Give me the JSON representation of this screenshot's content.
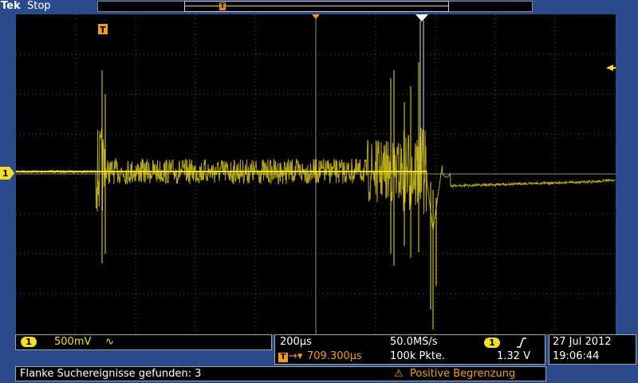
{
  "header": {
    "brand": "Tek",
    "status": "Stop"
  },
  "channel": {
    "label": "1",
    "scale": "500mV",
    "coupling_symbol": "∿"
  },
  "timebase": {
    "scale": "200µs",
    "sample_rate": "50.0MS/s",
    "trigger_delay": "709.300µs",
    "record_length": "100k Pkte.",
    "trigger_channel": "1",
    "trigger_slope": "rising",
    "trigger_level": "1.32 V"
  },
  "datetime": {
    "date": "27 Jul 2012",
    "time": "19:06:44"
  },
  "messages": {
    "search_result": "Flanke Suchereignisse gefunden: 3",
    "warning": "Positive Begrenzung"
  },
  "colors": {
    "trace": "#f2e020",
    "accent": "#f39b1a",
    "chrome": "#2a4a8c"
  },
  "icons": [
    "trigger-position-icon",
    "search-marker-icon",
    "trigger-level-arrow-icon",
    "warning-icon"
  ]
}
